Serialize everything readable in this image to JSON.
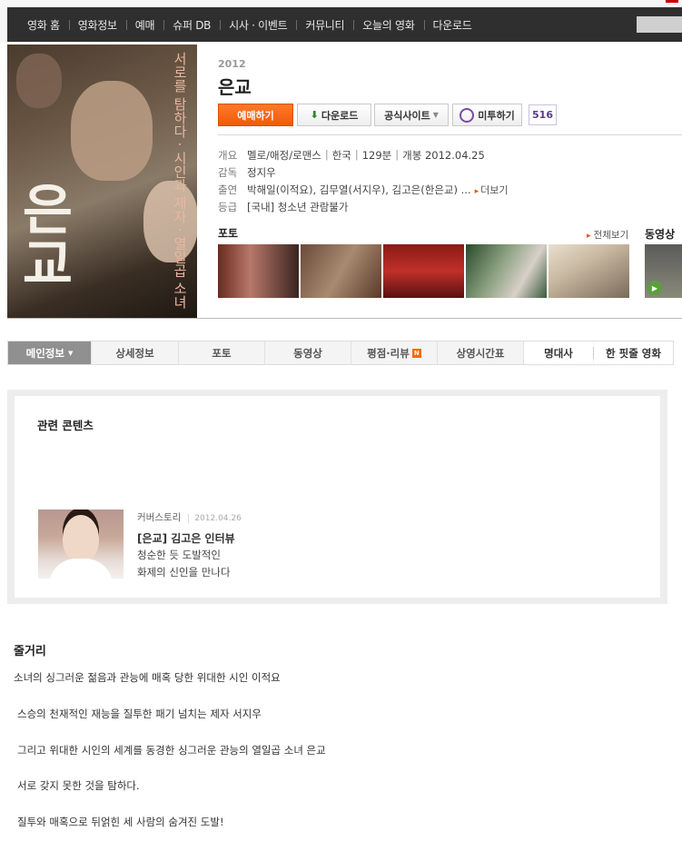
{
  "nav": {
    "items": [
      "영화 홈",
      "영화정보",
      "예매",
      "슈퍼 DB",
      "시사 · 이벤트",
      "커뮤니티",
      "오늘의 영화",
      "다운로드"
    ]
  },
  "poster": {
    "tagline": "서로를 탐하다 · 시인과 제자 · 열일곱 소녀",
    "title": "은교"
  },
  "movie": {
    "year": "2012",
    "title": "은교"
  },
  "buttons": {
    "reserve": "예매하기",
    "download": "다운로드",
    "official": "공식사이트",
    "metoo": "미투하기",
    "metoo_count": "516"
  },
  "info": {
    "overview_label": "개요",
    "genre": "멜로/애정/로맨스",
    "country": "한국",
    "runtime": "129분",
    "release": "개봉 2012.04.25",
    "director_label": "감독",
    "director": "정지우",
    "cast_label": "출연",
    "cast": "박해일(이적요), 김무열(서지우), 김고은(한은교) ...",
    "cast_more": "더보기",
    "rating_label": "등급",
    "rating": "[국내] 청소년 관람불가"
  },
  "media": {
    "photo_label": "포토",
    "photo_all": "전체보기",
    "video_label": "동영상"
  },
  "tabs": {
    "main": "메인정보",
    "detail": "상세정보",
    "photo": "포토",
    "video": "동영상",
    "review": "평점·리뷰",
    "review_badge": "N",
    "showtimes": "상영시간표",
    "quotes": "명대사",
    "one_line": "한 핏줄 영화"
  },
  "related": {
    "title": "관련 콘텐츠",
    "category": "커버스토리",
    "date": "2012.04.26",
    "headline": "[은교] 김고은 인터뷰",
    "line1": "청순한 듯 도발적인",
    "line2": "화제의 신인을 만나다"
  },
  "synopsis": {
    "title": "줄거리",
    "lines": [
      "소녀의 싱그러운 젊음과 관능에 매혹 당한 위대한 시인 이적요",
      "스승의 천재적인 재능을 질투한 패기 넘치는 제자 서지우",
      "그리고 위대한 시인의 세계를 동경한 싱그러운 관능의 열일곱 소녀 은교",
      "서로 갖지 못한 것을 탐하다.",
      "질투와 매혹으로 뒤얽힌 세 사람의 숨겨진 도발!"
    ]
  },
  "colors": {
    "accent_orange": "#f05a0a",
    "nav_bg": "#2f2f2f",
    "metoo_purple": "#5b3a8c"
  }
}
